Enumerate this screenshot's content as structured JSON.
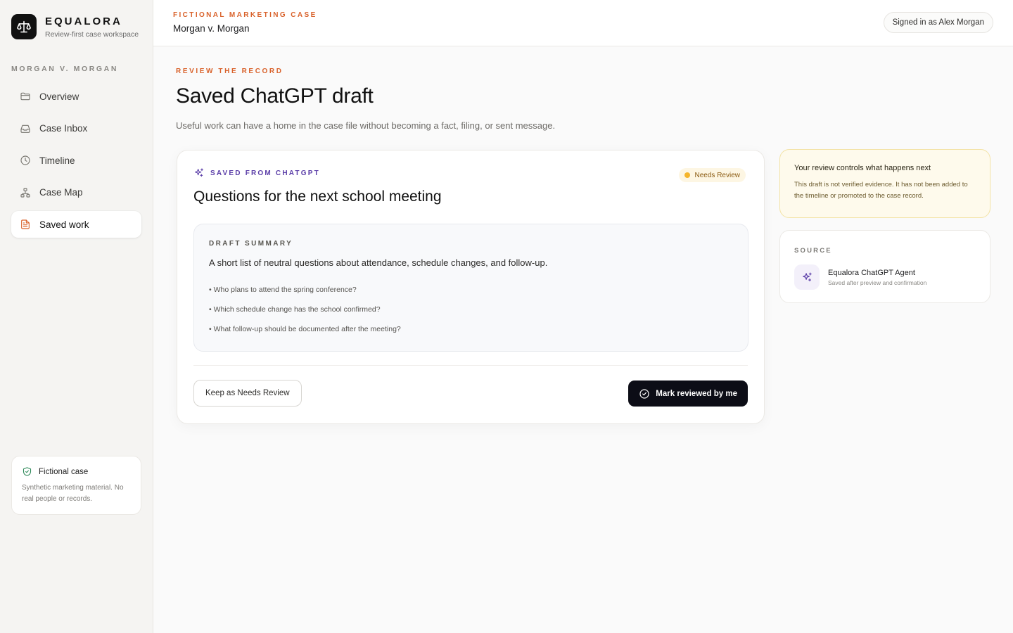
{
  "brand": {
    "name": "EQUALORA",
    "tagline": "Review-first case workspace"
  },
  "sidebar": {
    "case_label": "MORGAN V. MORGAN",
    "items": [
      {
        "label": "Overview",
        "icon": "folder-icon",
        "active": false
      },
      {
        "label": "Case Inbox",
        "icon": "inbox-icon",
        "active": false
      },
      {
        "label": "Timeline",
        "icon": "clock-icon",
        "active": false
      },
      {
        "label": "Case Map",
        "icon": "network-icon",
        "active": false
      },
      {
        "label": "Saved work",
        "icon": "document-icon",
        "active": true
      }
    ],
    "note": {
      "title": "Fictional case",
      "body": "Synthetic marketing material. No real people or records.",
      "icon": "shield-check-icon"
    }
  },
  "topbar": {
    "eyebrow": "FICTIONAL MARKETING CASE",
    "title": "Morgan v. Morgan",
    "signed_in": "Signed in as Alex Morgan"
  },
  "main": {
    "eyebrow": "REVIEW THE RECORD",
    "title": "Saved ChatGPT draft",
    "subtitle": "Useful work can have a home in the case file without becoming a fact, filing, or sent message."
  },
  "draft": {
    "eyebrow": "SAVED FROM CHATGPT",
    "badge": "Needs Review",
    "title": "Questions for the next school meeting",
    "summary_label": "DRAFT SUMMARY",
    "summary": "A short list of neutral questions about attendance, schedule changes, and follow-up.",
    "questions": [
      "• Who plans to attend the spring conference?",
      "• Which schedule change has the school confirmed?",
      "• What follow-up should be documented after the meeting?"
    ],
    "keep_button": "Keep as Needs Review",
    "review_button": "Mark reviewed by me"
  },
  "notice": {
    "title": "Your review controls what happens next",
    "body": "This draft is not verified evidence. It has not been added to the timeline or promoted to the case record."
  },
  "source": {
    "label": "SOURCE",
    "name": "Equalora ChatGPT Agent",
    "description": "Saved after preview and confirmation"
  },
  "colors": {
    "accent_orange": "#d9622b",
    "accent_purple": "#5b3ea8",
    "badge_dot": "#f5b52c",
    "primary_button": "#0c0d16"
  }
}
